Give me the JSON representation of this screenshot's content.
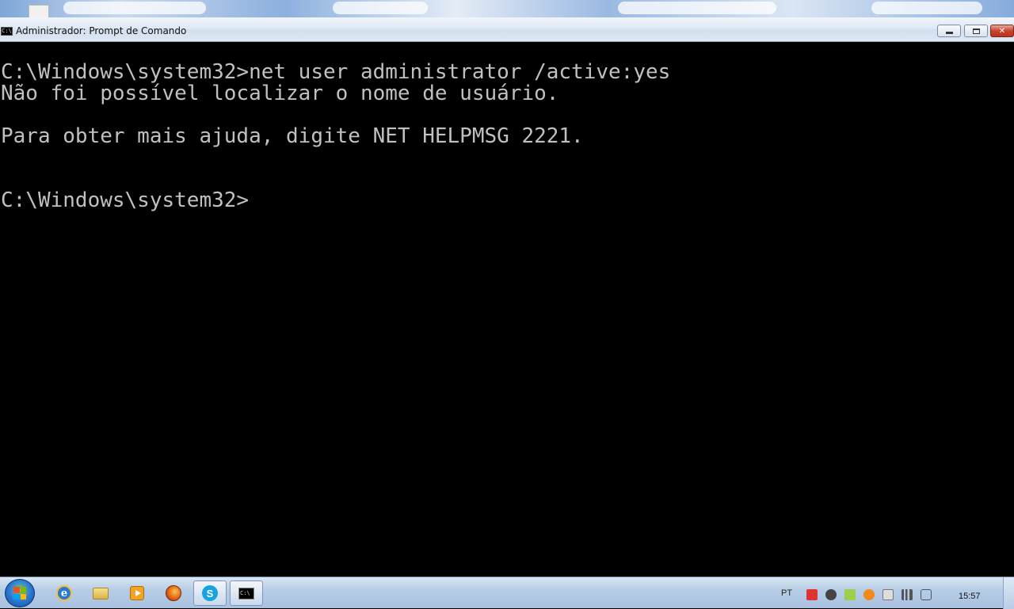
{
  "window": {
    "title": "Administrador: Prompt de Comando",
    "icon_text": "C:\\",
    "buttons": {
      "minimize": "minimize-icon",
      "maximize": "maximize-icon",
      "close": "✕"
    }
  },
  "console": {
    "lines": [
      "C:\\Windows\\system32>net user administrator /active:yes",
      "Não foi possível localizar o nome de usuário.",
      "Para obter mais ajuda, digite NET HELPMSG 2221.",
      "C:\\Windows\\system32>"
    ],
    "background": "#000000",
    "foreground": "#c0c0c0"
  },
  "taskbar": {
    "pinned": [
      {
        "name": "internet-explorer-icon",
        "label": "e"
      },
      {
        "name": "folder-icon"
      },
      {
        "name": "media-player-icon"
      },
      {
        "name": "firefox-icon"
      },
      {
        "name": "skype-icon",
        "label": "S"
      },
      {
        "name": "command-prompt-icon",
        "label": "C:\\"
      }
    ],
    "tray": {
      "language": "PT",
      "clock": "15:57"
    }
  }
}
